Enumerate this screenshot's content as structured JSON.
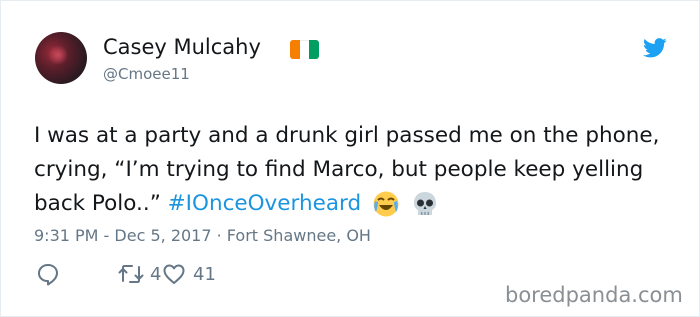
{
  "tweet": {
    "display_name": "Casey Mulcahy",
    "handle": "@Cmoee11",
    "flag_colors": [
      "#f77f00",
      "#ffffff",
      "#009e60"
    ],
    "text_before": "I was at a party and a drunk girl passed me on the phone, crying, “I’m trying to find Marco, but people keep yelling back Polo..” ",
    "hashtag": "#IOnceOverheard",
    "emojis": [
      "face-with-tears-of-joy",
      "skull"
    ],
    "meta": "9:31 PM - Dec 5, 2017 · Fort Shawnee, OH",
    "retweet_count": "4",
    "like_count": "41"
  },
  "colors": {
    "twitter_blue": "#1da1f2",
    "hashtag_blue": "#1b95e0",
    "secondary_text": "#657786",
    "primary_text": "#14171a"
  },
  "icons": [
    "twitter-bird-icon",
    "reply-icon",
    "retweet-icon",
    "like-icon"
  ],
  "watermark": "boredpanda.com"
}
